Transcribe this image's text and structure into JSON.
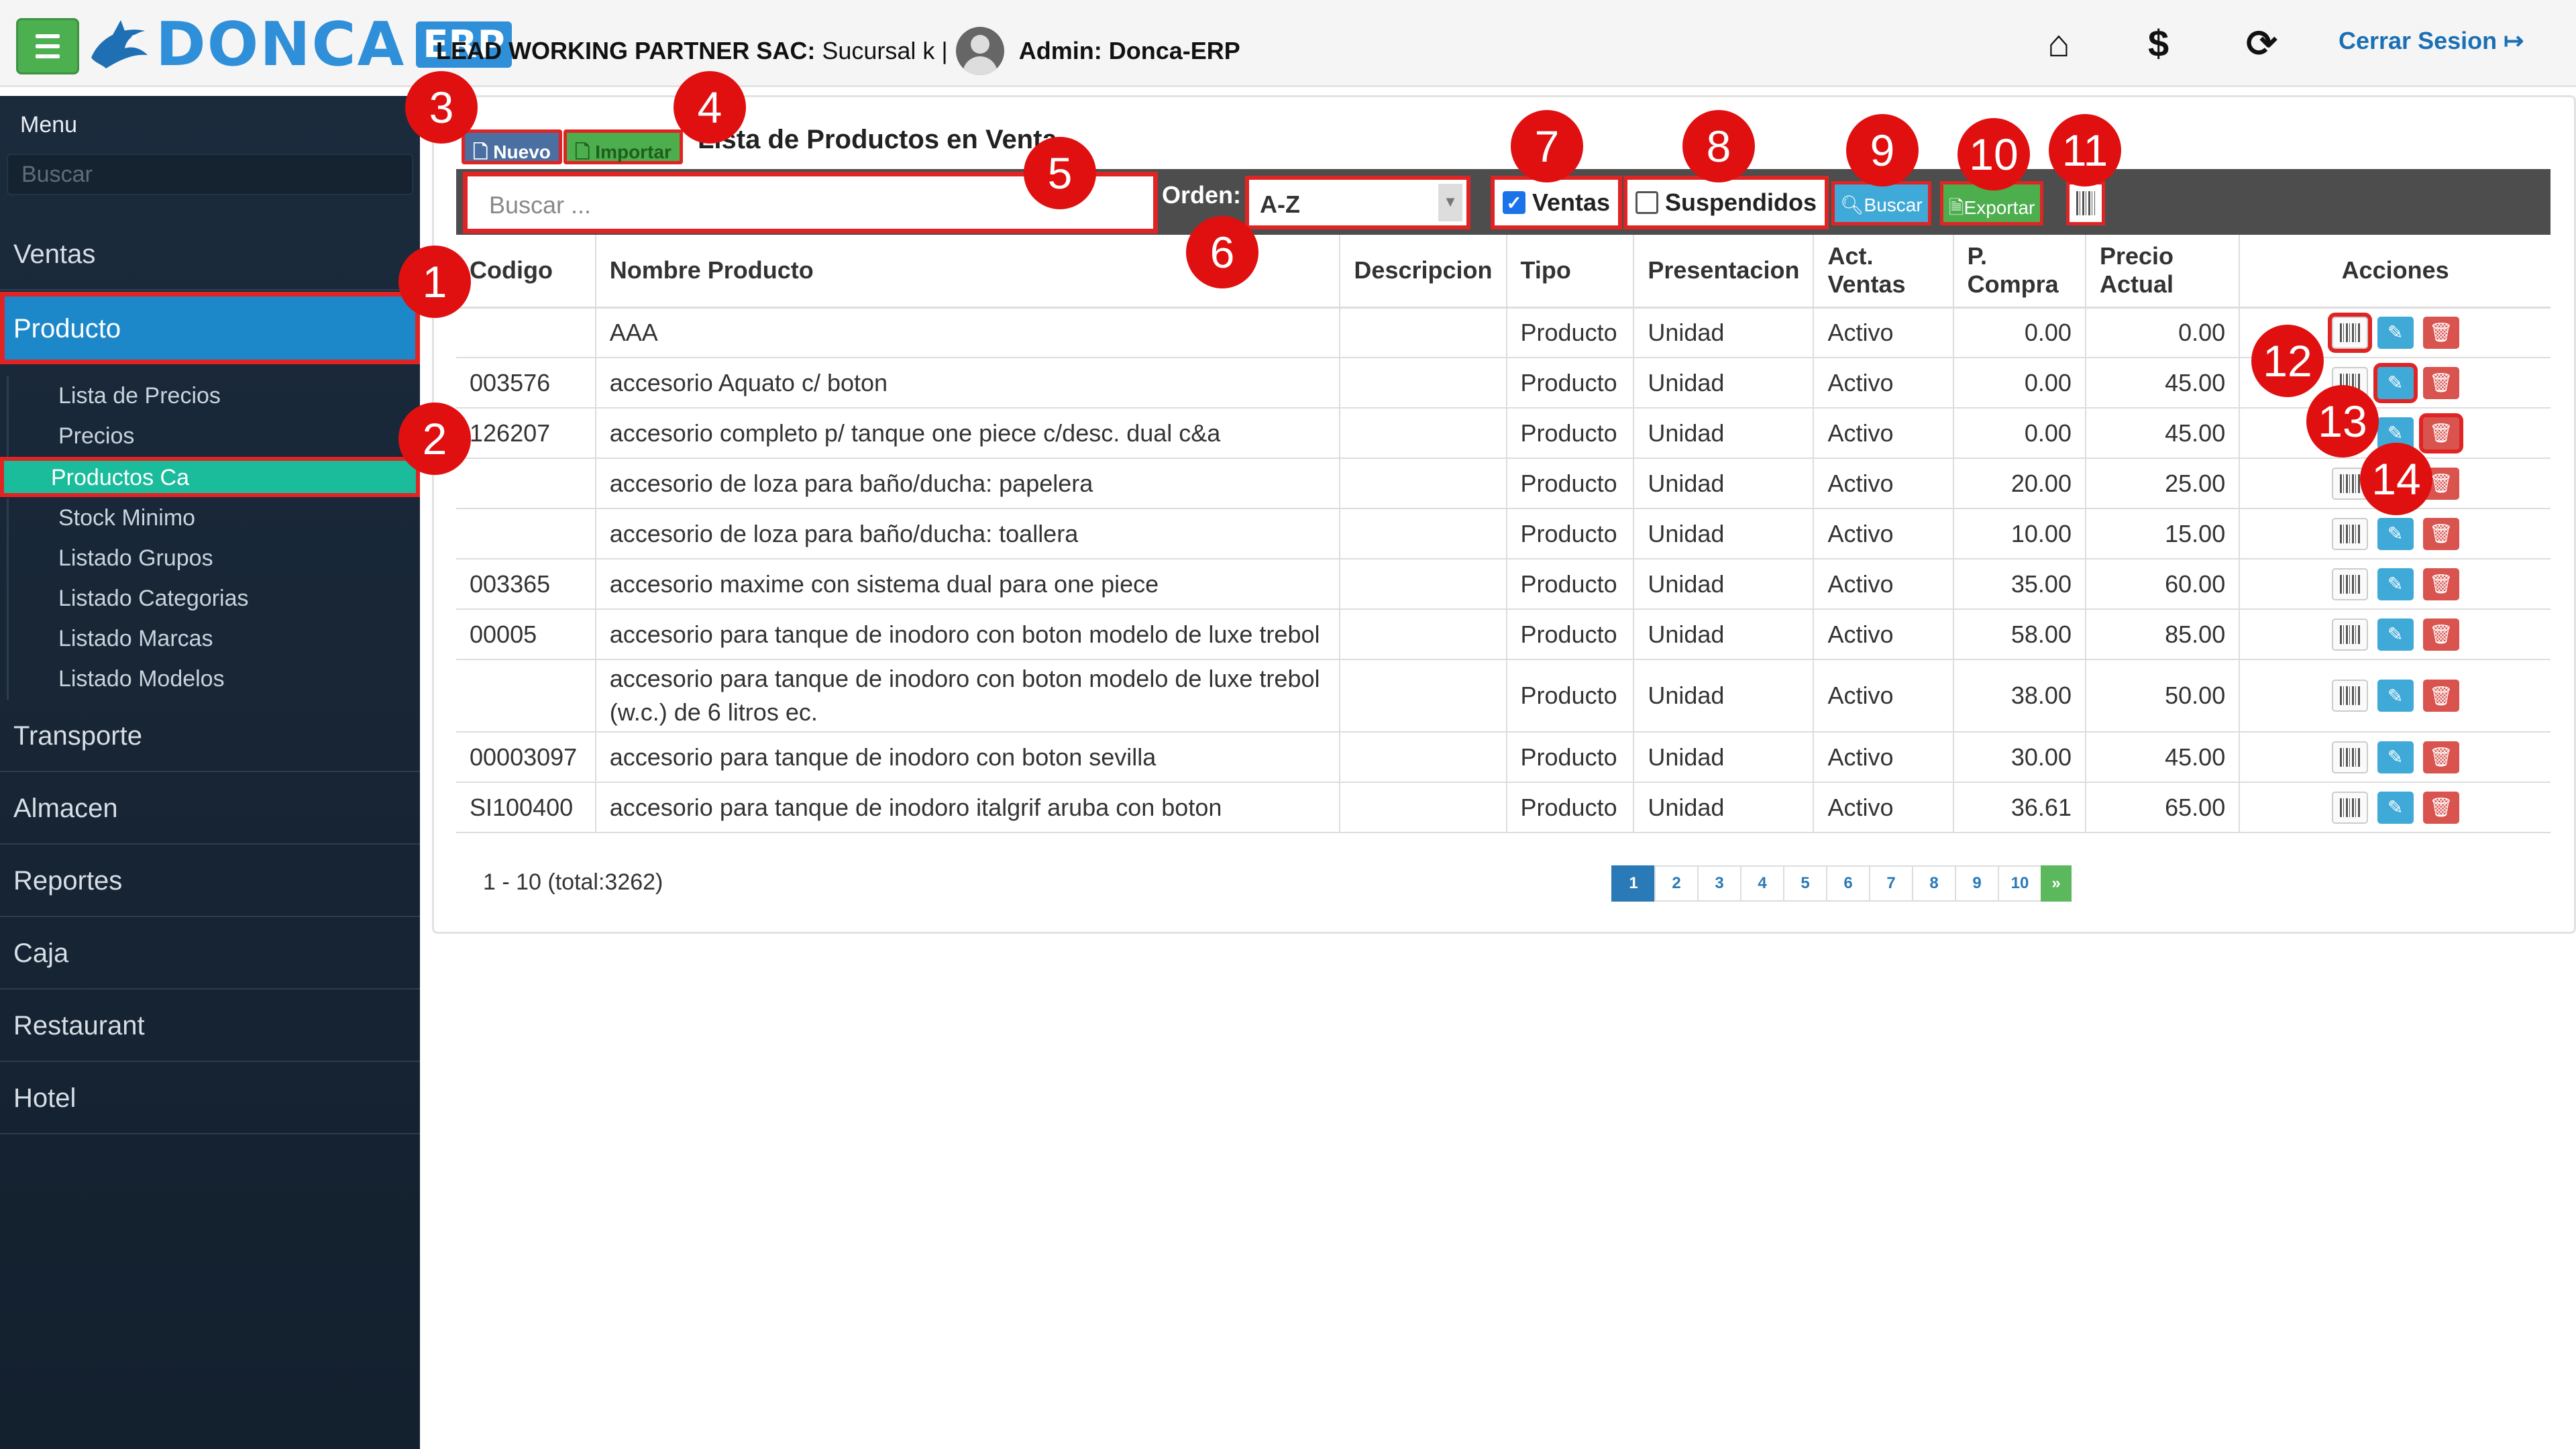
{
  "header": {
    "brand": "DONCA",
    "brand_suffix": "ERP",
    "company": "LEAD WORKING PARTNER SAC:",
    "branch": "Sucursal k |",
    "admin": "Admin: Donca-ERP",
    "logout": "Cerrar Sesion",
    "icons": [
      "home-icon",
      "dollar-icon",
      "lock-refresh-icon",
      "logout-icon"
    ]
  },
  "sidebar": {
    "title": "Menu",
    "search_placeholder": "Buscar",
    "items": [
      {
        "label": "Ventas"
      },
      {
        "label": "Producto"
      },
      {
        "label": "Transporte"
      },
      {
        "label": "Almacen"
      },
      {
        "label": "Reportes"
      },
      {
        "label": "Caja"
      },
      {
        "label": "Restaurant"
      },
      {
        "label": "Hotel"
      }
    ],
    "sub_items": [
      {
        "label": "Lista de Precios"
      },
      {
        "label": "Precios"
      },
      {
        "label": "Productos Ca"
      },
      {
        "label": "Stock Minimo"
      },
      {
        "label": "Listado Grupos"
      },
      {
        "label": "Listado Categorias"
      },
      {
        "label": "Listado Marcas"
      },
      {
        "label": "Listado Modelos"
      }
    ]
  },
  "panel": {
    "nuevo": "Nuevo",
    "importar": "Importar",
    "title": "Lista de Productos en Venta",
    "search_placeholder": "Buscar ...",
    "orden_label": "Orden:",
    "orden_value": "A-Z",
    "ventas_label": "Ventas",
    "ventas_checked": true,
    "suspendidos_label": "Suspendidos",
    "suspendidos_checked": false,
    "buscar": "Buscar",
    "exportar": "Exportar"
  },
  "table": {
    "headers": [
      "Codigo",
      "Nombre Producto",
      "Descripcion",
      "Tipo",
      "Presentacion",
      "Act. Ventas",
      "P. Compra",
      "Precio Actual",
      "Acciones"
    ],
    "rows": [
      {
        "codigo": "",
        "nombre": "AAA",
        "descripcion": "",
        "tipo": "Producto",
        "presentacion": "Unidad",
        "estado": "Activo",
        "compra": "0.00",
        "precio": "0.00"
      },
      {
        "codigo": "003576",
        "nombre": "accesorio Aquato c/ boton",
        "descripcion": "",
        "tipo": "Producto",
        "presentacion": "Unidad",
        "estado": "Activo",
        "compra": "0.00",
        "precio": "45.00"
      },
      {
        "codigo": "126207",
        "nombre": "accesorio completo p/ tanque one piece c/desc. dual c&a",
        "descripcion": "",
        "tipo": "Producto",
        "presentacion": "Unidad",
        "estado": "Activo",
        "compra": "0.00",
        "precio": "45.00"
      },
      {
        "codigo": "",
        "nombre": "accesorio de loza para baño/ducha: papelera",
        "descripcion": "",
        "tipo": "Producto",
        "presentacion": "Unidad",
        "estado": "Activo",
        "compra": "20.00",
        "precio": "25.00"
      },
      {
        "codigo": "",
        "nombre": "accesorio de loza para baño/ducha: toallera",
        "descripcion": "",
        "tipo": "Producto",
        "presentacion": "Unidad",
        "estado": "Activo",
        "compra": "10.00",
        "precio": "15.00"
      },
      {
        "codigo": "003365",
        "nombre": "accesorio maxime con sistema dual para one piece",
        "descripcion": "",
        "tipo": "Producto",
        "presentacion": "Unidad",
        "estado": "Activo",
        "compra": "35.00",
        "precio": "60.00"
      },
      {
        "codigo": "00005",
        "nombre": "accesorio para tanque de inodoro con boton modelo de luxe trebol",
        "descripcion": "",
        "tipo": "Producto",
        "presentacion": "Unidad",
        "estado": "Activo",
        "compra": "58.00",
        "precio": "85.00"
      },
      {
        "codigo": "",
        "nombre": "accesorio para tanque de inodoro con boton modelo de luxe trebol (w.c.) de 6 litros ec.",
        "descripcion": "",
        "tipo": "Producto",
        "presentacion": "Unidad",
        "estado": "Activo",
        "compra": "38.00",
        "precio": "50.00"
      },
      {
        "codigo": "00003097",
        "nombre": "accesorio para tanque de inodoro con boton sevilla",
        "descripcion": "",
        "tipo": "Producto",
        "presentacion": "Unidad",
        "estado": "Activo",
        "compra": "30.00",
        "precio": "45.00"
      },
      {
        "codigo": "SI100400",
        "nombre": "accesorio para tanque de inodoro italgrif aruba con boton",
        "descripcion": "",
        "tipo": "Producto",
        "presentacion": "Unidad",
        "estado": "Activo",
        "compra": "36.61",
        "precio": "65.00"
      }
    ]
  },
  "pagination": {
    "info": "1 - 10 (total:3262)",
    "pages": [
      "1",
      "2",
      "3",
      "4",
      "5",
      "6",
      "7",
      "8",
      "9",
      "10"
    ],
    "next": "»",
    "current": "1"
  },
  "annotations": [
    "1",
    "2",
    "3",
    "4",
    "5",
    "6",
    "7",
    "8",
    "9",
    "10",
    "11",
    "12",
    "13",
    "14"
  ],
  "colors": {
    "sidebar_bg": "#182636",
    "active_item": "#1d88c9",
    "active_sub": "#1abc9c",
    "highlight": "#e02424",
    "badge": "#e01010"
  }
}
